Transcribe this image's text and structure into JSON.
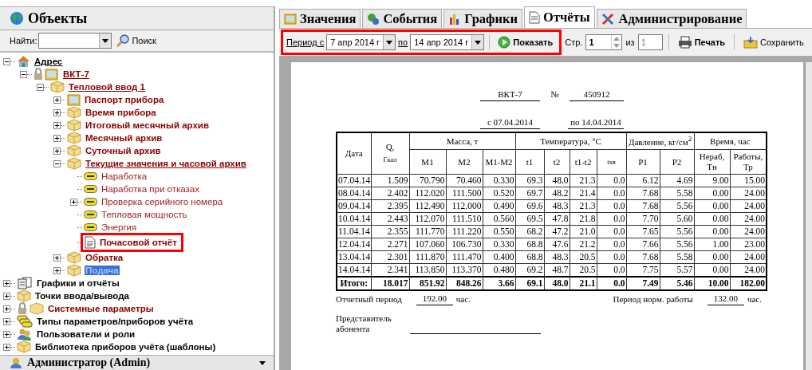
{
  "panel": {
    "title": "Объекты",
    "find_label": "Найти:",
    "search_button": "Поиск"
  },
  "tree": [
    {
      "label": "Адрес",
      "kind": "house",
      "bold": true,
      "underlined": true,
      "color": "#000000",
      "expanded": true,
      "selected": false,
      "highlighted": false,
      "children": [
        {
          "label": "ВКТ-7",
          "kind": "device-locked",
          "bold": true,
          "underlined": true,
          "color": "#8b0000",
          "expanded": true,
          "selected": false,
          "highlighted": false,
          "children": [
            {
              "label": "Тепловой ввод 1",
              "kind": "box",
              "bold": true,
              "underlined": true,
              "color": "#8b0000",
              "expanded": true,
              "selected": false,
              "highlighted": false,
              "children": [
                {
                  "label": "Паспорт прибора",
                  "kind": "device",
                  "bold": true,
                  "underlined": false,
                  "color": "#8b0000",
                  "expanded": false,
                  "selected": false,
                  "highlighted": false
                },
                {
                  "label": "Время прибора",
                  "kind": "box",
                  "bold": true,
                  "underlined": false,
                  "color": "#8b0000",
                  "expanded": false,
                  "selected": false,
                  "highlighted": false
                },
                {
                  "label": "Итоговый месячный архив",
                  "kind": "box",
                  "bold": true,
                  "underlined": false,
                  "color": "#8b0000",
                  "expanded": false,
                  "selected": false,
                  "highlighted": false
                },
                {
                  "label": "Месячный архив",
                  "kind": "box",
                  "bold": true,
                  "underlined": false,
                  "color": "#8b0000",
                  "expanded": false,
                  "selected": false,
                  "highlighted": false
                },
                {
                  "label": "Суточный архив",
                  "kind": "box",
                  "bold": true,
                  "underlined": false,
                  "color": "#8b0000",
                  "expanded": false,
                  "selected": false,
                  "highlighted": false
                },
                {
                  "label": "Текущие значения и часовой архив",
                  "kind": "box",
                  "bold": true,
                  "underlined": true,
                  "color": "#8b0000",
                  "expanded": true,
                  "selected": false,
                  "highlighted": false,
                  "children": [
                    {
                      "label": "Наработка",
                      "kind": "tag",
                      "bold": false,
                      "underlined": false,
                      "color": "#a02020",
                      "selected": false,
                      "highlighted": false
                    },
                    {
                      "label": "Наработка при отказах",
                      "kind": "tag",
                      "bold": false,
                      "underlined": false,
                      "color": "#a02020",
                      "selected": false,
                      "highlighted": false
                    },
                    {
                      "label": "Проверка серийного номера",
                      "kind": "tag",
                      "bold": false,
                      "underlined": false,
                      "color": "#a02020",
                      "expanded": false,
                      "selected": false,
                      "highlighted": false
                    },
                    {
                      "label": "Тепловая мощность",
                      "kind": "tag",
                      "bold": false,
                      "underlined": false,
                      "color": "#a02020",
                      "selected": false,
                      "highlighted": false
                    },
                    {
                      "label": "Энергия",
                      "kind": "tag",
                      "bold": false,
                      "underlined": false,
                      "color": "#a02020",
                      "selected": false,
                      "highlighted": false
                    },
                    {
                      "label": "Почасовой отчёт",
                      "kind": "report",
                      "bold": true,
                      "underlined": false,
                      "color": "#8b0000",
                      "selected": false,
                      "highlighted": true
                    }
                  ]
                },
                {
                  "label": "Обратка",
                  "kind": "box",
                  "bold": true,
                  "underlined": false,
                  "color": "#8b0000",
                  "expanded": false,
                  "selected": false,
                  "highlighted": false
                },
                {
                  "label": "Подача",
                  "kind": "box",
                  "bold": true,
                  "underlined": false,
                  "expanded": false,
                  "selected": true,
                  "highlighted": false
                }
              ]
            }
          ]
        }
      ]
    },
    {
      "label": "Графики и отчёты",
      "kind": "charts",
      "bold": true,
      "underlined": false,
      "color": "#000000",
      "expanded": false,
      "selected": false,
      "highlighted": false
    },
    {
      "label": "Точки ввода/вывода",
      "kind": "box",
      "bold": true,
      "underlined": false,
      "color": "#000000",
      "expanded": false,
      "selected": false,
      "highlighted": false
    },
    {
      "label": "Системные параметры",
      "kind": "box-locked",
      "bold": true,
      "underlined": false,
      "color": "#8b0000",
      "expanded": false,
      "selected": false,
      "highlighted": false
    },
    {
      "label": "Типы параметров/приборов учёта",
      "kind": "types",
      "bold": true,
      "underlined": false,
      "color": "#000000",
      "expanded": false,
      "selected": false,
      "highlighted": false
    },
    {
      "label": "Пользователи и роли",
      "kind": "users",
      "bold": true,
      "underlined": false,
      "color": "#000000",
      "expanded": false,
      "selected": false,
      "highlighted": false
    },
    {
      "label": "Библиотека приборов учёта (шаблоны)",
      "kind": "box",
      "bold": true,
      "underlined": false,
      "color": "#000000",
      "expanded": false,
      "selected": false,
      "highlighted": false
    }
  ],
  "user": {
    "name": "Администратор (Admin)"
  },
  "tabs": [
    {
      "label": "Значения",
      "kind": "values",
      "selected": false
    },
    {
      "label": "События",
      "kind": "events",
      "selected": false
    },
    {
      "label": "Графики",
      "kind": "charts",
      "selected": false
    },
    {
      "label": "Отчёты",
      "kind": "reports",
      "selected": true
    },
    {
      "label": "Администрирование",
      "kind": "admin",
      "selected": false
    }
  ],
  "toolbar": {
    "period_label": "Период с",
    "from": "7 апр 2014 г",
    "to_label": "по",
    "to": "14 апр 2014 г",
    "show_button": "Показать",
    "highlighted": true,
    "page_label": "Стр.",
    "page": "1",
    "of_label": "из",
    "pages": "1",
    "print_button": "Печать",
    "save_button": "Сохранить"
  },
  "report": {
    "device": "ВКТ-7",
    "number_label": "№",
    "number": "450912",
    "from": "с 07.04.2014",
    "to": "по 14.04.2014",
    "header": {
      "date": "Дата",
      "q": "Q,",
      "q_unit": "Гкал",
      "mass": "Масса, т",
      "temp": "Температура, °С",
      "pressure": "Давление, кг/см$^{2}$",
      "time": "Время, час",
      "sub": [
        "M1",
        "M2",
        "M1-M2",
        "t1",
        "t2",
        "t1-t2",
        "tхв",
        "P1",
        "P2",
        "Нераб, Тн",
        "Работы, Тр"
      ]
    },
    "rows": [
      [
        "07.04.14",
        "1.509",
        "70.790",
        "70.460",
        "0.330",
        "69.3",
        "48.0",
        "21.3",
        "0.0",
        "6.12",
        "4.69",
        "9.00",
        "15.00"
      ],
      [
        "08.04.14",
        "2.402",
        "112.020",
        "111.500",
        "0.520",
        "69.7",
        "48.2",
        "21.4",
        "0.0",
        "7.68",
        "5.58",
        "0.00",
        "24.00"
      ],
      [
        "09.04.14",
        "2.395",
        "112.490",
        "112.000",
        "0.490",
        "69.6",
        "48.3",
        "21.3",
        "0.0",
        "7.68",
        "5.56",
        "0.00",
        "24.00"
      ],
      [
        "10.04.14",
        "2.443",
        "112.070",
        "111.510",
        "0.560",
        "69.5",
        "47.8",
        "21.8",
        "0.0",
        "7.70",
        "5.60",
        "0.00",
        "24.00"
      ],
      [
        "11.04.14",
        "2.355",
        "111.770",
        "111.220",
        "0.550",
        "68.2",
        "47.2",
        "21.0",
        "0.0",
        "7.65",
        "5.56",
        "0.00",
        "24.00"
      ],
      [
        "12.04.14",
        "2.271",
        "107.060",
        "106.730",
        "0.330",
        "68.8",
        "47.6",
        "21.2",
        "0.0",
        "7.66",
        "5.56",
        "1.00",
        "23.00"
      ],
      [
        "13.04.14",
        "2.301",
        "111.870",
        "111.470",
        "0.400",
        "68.8",
        "48.3",
        "20.5",
        "0.0",
        "7.68",
        "5.58",
        "0.00",
        "24.00"
      ],
      [
        "14.04.14",
        "2.341",
        "113.850",
        "113.370",
        "0.480",
        "69.2",
        "48.7",
        "20.5",
        "0.0",
        "7.75",
        "5.57",
        "0.00",
        "24.00"
      ]
    ],
    "total": [
      "Итого:",
      "18.017",
      "851.92",
      "848.26",
      "3.66",
      "69.1",
      "48.0",
      "21.1",
      "0.0",
      "7.49",
      "5.46",
      "10.00",
      "182.00"
    ],
    "period_label": "Отчетный период",
    "period": "192.00",
    "period_unit": "час.",
    "norm_label": "Период норм. работы",
    "norm": "132.00",
    "norm_unit": "час.",
    "rep_label": "Представитель абонента"
  }
}
